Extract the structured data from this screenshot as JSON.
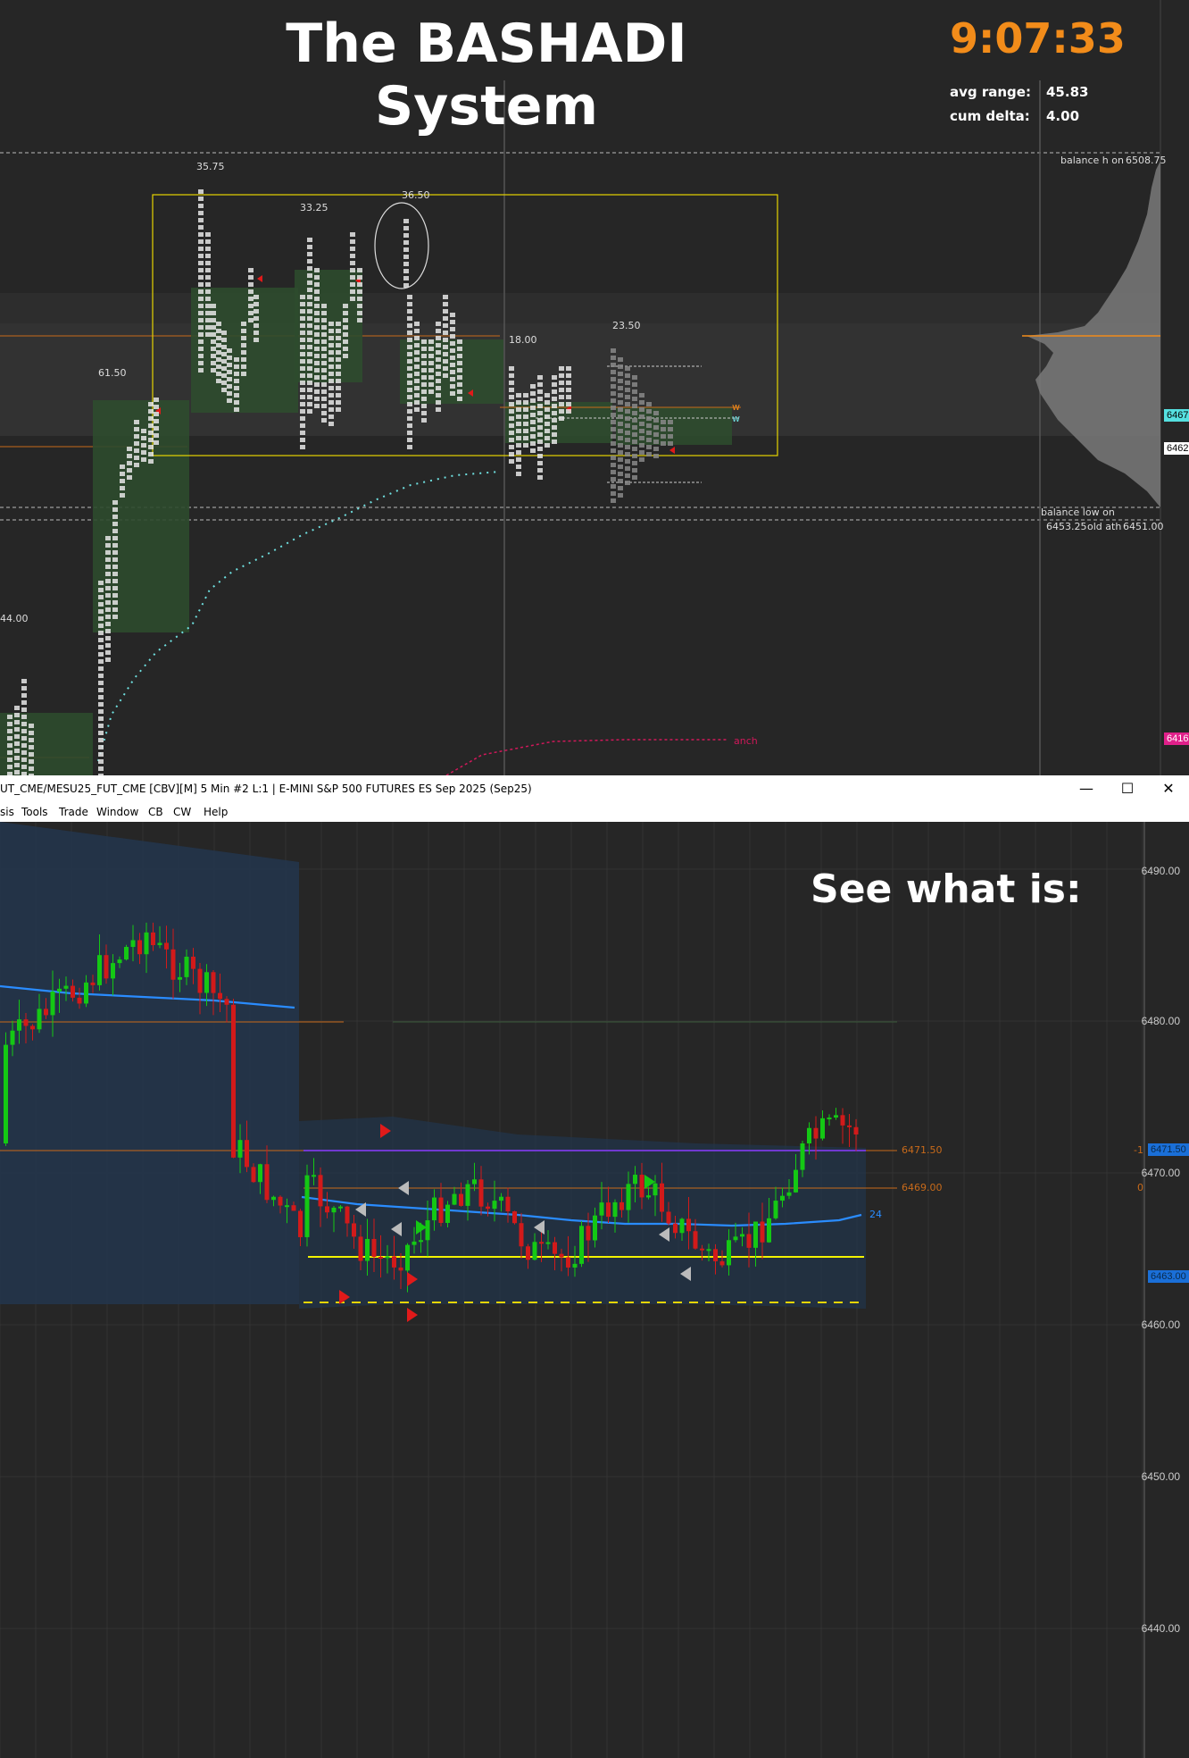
{
  "top_panel": {
    "title": "The BASHADI System",
    "clock": "9:07:33",
    "avg_range_label": "avg range:",
    "avg_range_value": "45.83",
    "cum_delta_label": "cum delta:",
    "cum_delta_value": "4.00",
    "balance_high_label": "balance h on",
    "balance_high_value": "6508.75",
    "balance_low_label": "balance low on",
    "balance_low_value": "6453.25",
    "old_ath_label": "old ath",
    "old_ath_value": "6451.00",
    "range_labels": [
      "35.75",
      "33.25",
      "36.50",
      "61.50",
      "18.00",
      "23.50",
      "44.00"
    ],
    "anch_label": "anch",
    "right_tags": [
      "6467.",
      "6462.",
      "6416"
    ],
    "w_marks": [
      "w",
      "w"
    ]
  },
  "window": {
    "title": "UT_CME/MESU25_FUT_CME [CBV][M]  5 Min  #2 L:1 | E-MINI S&P 500 FUTURES ES Sep 2025 (Sep25)",
    "controls": {
      "minimize": "—",
      "maximize": "☐",
      "close": "✕"
    },
    "menu": [
      "sis",
      "Tools",
      "Trade",
      "Window",
      "CB",
      "CW",
      "Help"
    ]
  },
  "bottom_panel": {
    "headline": "See what is:",
    "axis_labels": [
      "6490.00",
      "6480.00",
      "6470.00",
      "6460.00",
      "6450.00",
      "6440.00"
    ],
    "price_line_labels": [
      "6471.50",
      "6469.00"
    ],
    "right_tags": [
      "6471.50",
      "6463.00"
    ],
    "marker_24": "24",
    "side_marks": [
      "-1",
      "0"
    ]
  },
  "colors": {
    "background": "#262626",
    "clock": "#f28c1a",
    "profile_box": "#e6d400",
    "value_area": "#2f4a2f",
    "vwap_dots": "#6fe0e0",
    "anch_line": "#d0185a",
    "up_candle": "#14c814",
    "down_candle": "#d21a1a",
    "ma_line": "#2a8cff",
    "yellow_line": "#f2f200",
    "purple_line": "#8a3cff",
    "orange_line": "#c86a1a",
    "tag_blue": "#1a6fd8",
    "tag_cyan": "#55e0e0",
    "tag_pink": "#e0208a"
  }
}
